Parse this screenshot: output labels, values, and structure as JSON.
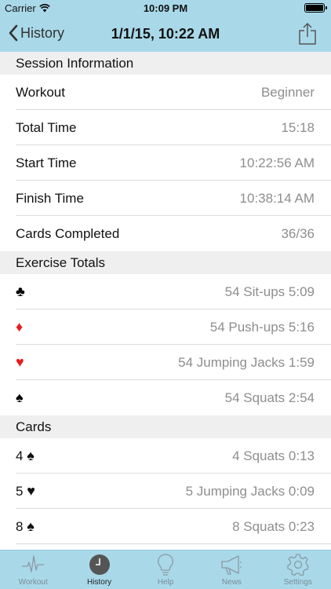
{
  "status_bar": {
    "carrier": "Carrier",
    "time": "10:09 PM"
  },
  "nav": {
    "back_label": "History",
    "title": "1/1/15, 10:22 AM"
  },
  "session": {
    "header": "Session Information",
    "rows": [
      {
        "label": "Workout",
        "value": "Beginner"
      },
      {
        "label": "Total Time",
        "value": "15:18"
      },
      {
        "label": "Start Time",
        "value": "10:22:56 AM"
      },
      {
        "label": "Finish Time",
        "value": "10:38:14 AM"
      },
      {
        "label": "Cards Completed",
        "value": "36/36"
      }
    ]
  },
  "exercise": {
    "header": "Exercise Totals",
    "rows": [
      {
        "suit": "♣",
        "color": "#000000",
        "value": "54 Sit-ups 5:09"
      },
      {
        "suit": "♦",
        "color": "#e41e1e",
        "value": "54 Push-ups 5:16"
      },
      {
        "suit": "♥",
        "color": "#e41e1e",
        "value": "54 Jumping Jacks 1:59"
      },
      {
        "suit": "♠",
        "color": "#000000",
        "value": "54 Squats 2:54"
      }
    ]
  },
  "cards": {
    "header": "Cards",
    "rows": [
      {
        "rank": "4",
        "suit": "♠",
        "color": "#000000",
        "value": "4 Squats 0:13"
      },
      {
        "rank": "5",
        "suit": "♥",
        "color": "#e41e1e",
        "value": "5 Jumping Jacks 0:09"
      },
      {
        "rank": "8",
        "suit": "♠",
        "color": "#000000",
        "value": "8 Squats 0:23"
      }
    ]
  },
  "tabs": [
    {
      "label": "Workout",
      "icon": "heartbeat-icon",
      "active": false
    },
    {
      "label": "History",
      "icon": "clock-icon",
      "active": true
    },
    {
      "label": "Help",
      "icon": "lightbulb-icon",
      "active": false
    },
    {
      "label": "News",
      "icon": "megaphone-icon",
      "active": false
    },
    {
      "label": "Settings",
      "icon": "gear-icon",
      "active": false
    }
  ],
  "colors": {
    "bar": "#a9d9e9",
    "red_suit": "#e41e1e",
    "value_gray": "#8e8e8e"
  }
}
